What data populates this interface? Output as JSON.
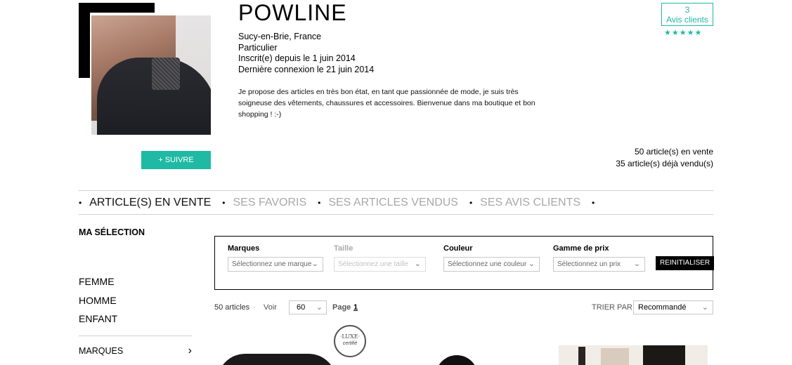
{
  "profile": {
    "name": "POWLINE",
    "location": "Sucy-en-Brie, France",
    "account_type": "Particulier",
    "registered": "Inscrit(e) depuis le 1 juin 2014",
    "last_login": "Dernière connexion le 21 juin 2014",
    "bio": "Je propose des articles en très bon état, en tant que passionnée de mode, je suis très soigneuse des vêtements, chaussures et accessoires. Bienvenue dans ma boutique et bon shopping ! :-)",
    "follow_label": "+ SUIVRE"
  },
  "reviews": {
    "count": "3",
    "label": "Avis clients",
    "stars_display": "★★★★★",
    "rating": 5,
    "rating_max": 5
  },
  "stats": {
    "for_sale": "50 article(s) en vente",
    "sold": "35 article(s) déjà vendu(s)"
  },
  "tabs": [
    {
      "label": "ARTICLE(S) EN VENTE",
      "active": true
    },
    {
      "label": "SES FAVORIS",
      "active": false
    },
    {
      "label": "SES ARTICLES VENDUS",
      "active": false
    },
    {
      "label": "SES AVIS CLIENTS",
      "active": false
    }
  ],
  "sidebar": {
    "title": "MA SÉLECTION",
    "categories": [
      "FEMME",
      "HOMME",
      "ENFANT"
    ],
    "brands_label": "MARQUES"
  },
  "filters": {
    "brand": {
      "label": "Marques",
      "placeholder": "Sélectionnez une marque"
    },
    "size": {
      "label": "Taille",
      "placeholder": "Sélectionnez une taille"
    },
    "color": {
      "label": "Couleur",
      "placeholder": "Sélectionnez une couleur"
    },
    "price": {
      "label": "Gamme de prix",
      "placeholder": "Sélectionnez un prix"
    },
    "reset_label": "REINITIALISER"
  },
  "results": {
    "count_label": "50 articles",
    "separator": "·",
    "per_page_label": "Voir",
    "per_page_value": "60",
    "page_label": "Page",
    "page_number": "1",
    "sort_label": "TRIER PAR",
    "sort_value": "Recommandé"
  },
  "badges": {
    "luxe_top": "·LUXE·",
    "luxe_bottom": "certifié"
  },
  "colors": {
    "accent": "#1fb9a4",
    "text": "#111111",
    "muted": "#a8a8a8"
  }
}
